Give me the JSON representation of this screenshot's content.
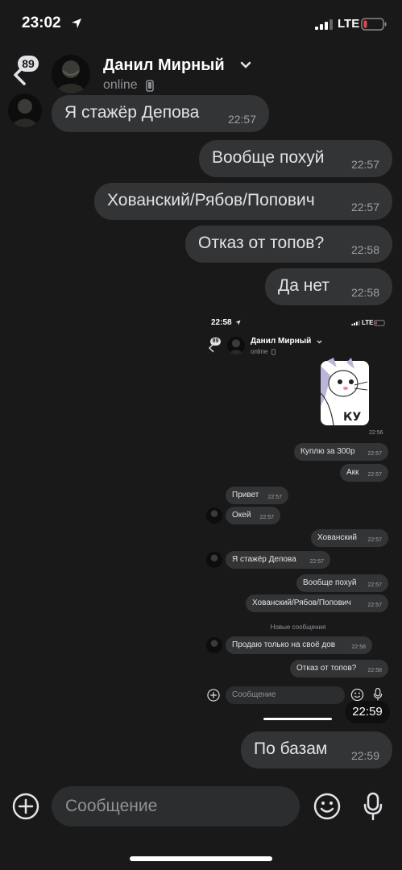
{
  "status_bar": {
    "time": "23:02",
    "network": "LTE"
  },
  "header": {
    "unread_count": "89",
    "name": "Данил Мирный",
    "status": "online"
  },
  "messages": [
    {
      "text": "Я стажёр Депова",
      "time": "22:57",
      "side": "in"
    },
    {
      "text": "Вообще похуй",
      "time": "22:57",
      "side": "out"
    },
    {
      "text": "Хованский/Рябов/Попович",
      "time": "22:57",
      "side": "out"
    },
    {
      "text": "Отказ от топов?",
      "time": "22:58",
      "side": "out"
    },
    {
      "text": "Да нет",
      "time": "22:58",
      "side": "out"
    },
    {
      "text": "По базам",
      "time": "22:59",
      "side": "out"
    }
  ],
  "screenshot_message": {
    "time": "22:59",
    "status_time": "22:58",
    "network": "LTE",
    "unread_count": "89",
    "name": "Данил Мирный",
    "status": "online",
    "sticker_text": "КУ",
    "sticker_time": "22:56",
    "messages": [
      {
        "text": "Куплю за 300р",
        "time": "22:57",
        "side": "out"
      },
      {
        "text": "Акк",
        "time": "22:57",
        "side": "out"
      },
      {
        "text": "Привет",
        "time": "22:57",
        "side": "in"
      },
      {
        "text": "Окей",
        "time": "22:57",
        "side": "in"
      },
      {
        "text": "Хованский",
        "time": "22:57",
        "side": "out"
      },
      {
        "text": "Я стажёр Депова",
        "time": "22:57",
        "side": "in"
      },
      {
        "text": "Вообще похуй",
        "time": "22:57",
        "side": "out"
      },
      {
        "text": "Хованский/Рябов/Попович",
        "time": "22:57",
        "side": "out"
      },
      {
        "text": "Продаю только на своё дов",
        "time": "22:58",
        "side": "in"
      },
      {
        "text": "Отказ от топов?",
        "time": "22:58",
        "side": "out"
      }
    ],
    "divider": "Новые сообщения",
    "input_placeholder": "Сообщение"
  },
  "input": {
    "placeholder": "Сообщение"
  },
  "colors": {
    "background": "#19191a",
    "bubble": "#333435",
    "text": "#e1e3e6",
    "secondary": "#8e9399"
  },
  "icons": [
    "location-arrow-icon",
    "signal-icon",
    "battery-low-icon",
    "back-icon",
    "chevron-down-icon",
    "phone-icon",
    "plus-icon",
    "smile-icon",
    "mic-icon"
  ]
}
